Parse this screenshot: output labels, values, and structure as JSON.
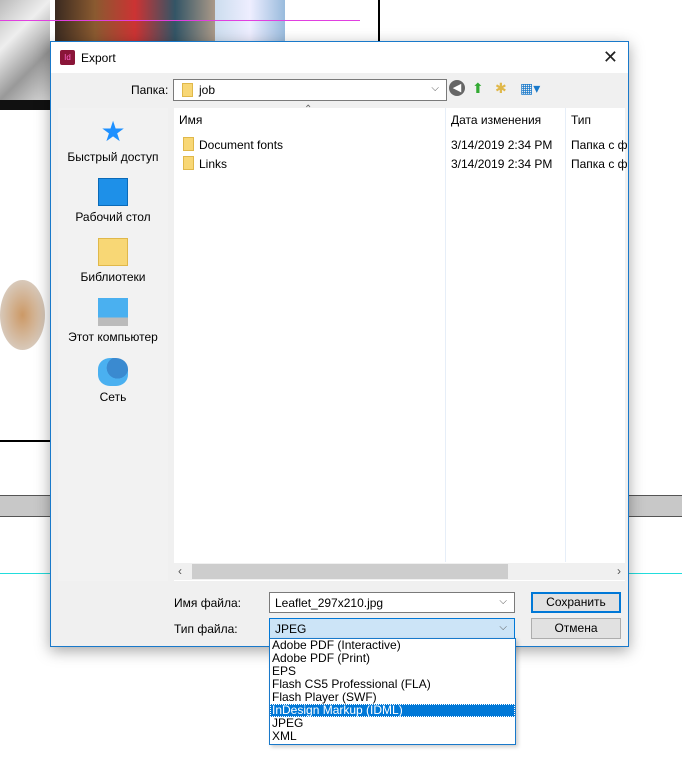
{
  "window": {
    "title": "Export",
    "app_icon": "ID"
  },
  "toolbar": {
    "folder_label": "Папка:",
    "folder_value": "job"
  },
  "sidebar": {
    "items": [
      {
        "label": "Быстрый доступ",
        "icon": "star-icon"
      },
      {
        "label": "Рабочий стол",
        "icon": "desktop-icon"
      },
      {
        "label": "Библиотеки",
        "icon": "library-icon"
      },
      {
        "label": "Этот компьютер",
        "icon": "computer-icon"
      },
      {
        "label": "Сеть",
        "icon": "network-icon"
      }
    ]
  },
  "list": {
    "columns": [
      "Имя",
      "Дата изменения",
      "Тип"
    ],
    "rows": [
      {
        "name": "Document fonts",
        "date": "3/14/2019 2:34 PM",
        "type": "Папка с ф"
      },
      {
        "name": "Links",
        "date": "3/14/2019 2:34 PM",
        "type": "Папка с ф"
      }
    ]
  },
  "form": {
    "filename_label": "Имя файла:",
    "filename_value": "Leaflet_297x210.jpg",
    "filetype_label": "Тип файла:",
    "filetype_value": "JPEG",
    "save_label": "Сохранить",
    "cancel_label": "Отмена"
  },
  "filetype_options": [
    "Adobe PDF (Interactive)",
    "Adobe PDF (Print)",
    "EPS",
    "Flash CS5 Professional (FLA)",
    "Flash Player (SWF)",
    "InDesign Markup (IDML)",
    "JPEG",
    "XML"
  ],
  "selected_option": "InDesign Markup (IDML)"
}
